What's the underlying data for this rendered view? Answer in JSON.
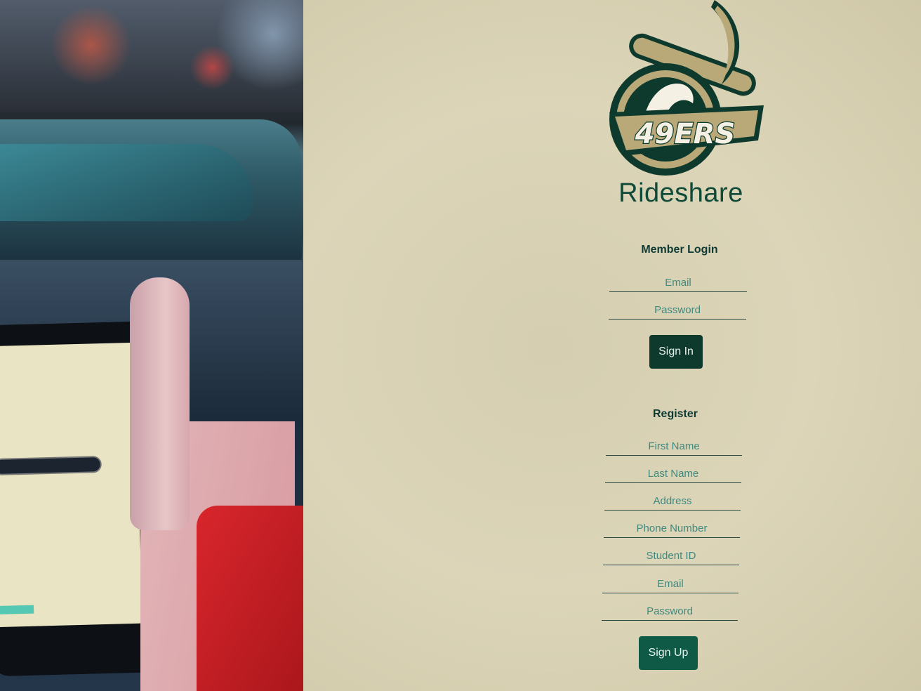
{
  "brand": {
    "logo_text": "49ERS",
    "app_name": "Rideshare",
    "colors": {
      "primary": "#0e3a2e",
      "accent": "#0f5a46",
      "gold": "#b9a878"
    }
  },
  "login": {
    "heading": "Member Login",
    "email_placeholder": "Email",
    "password_placeholder": "Password",
    "submit_label": "Sign In"
  },
  "register": {
    "heading": "Register",
    "first_name_placeholder": "First Name",
    "last_name_placeholder": "Last Name",
    "address_placeholder": "Address",
    "phone_placeholder": "Phone Number",
    "student_id_placeholder": "Student ID",
    "email_placeholder": "Email",
    "password_placeholder": "Password",
    "submit_label": "Sign Up"
  }
}
